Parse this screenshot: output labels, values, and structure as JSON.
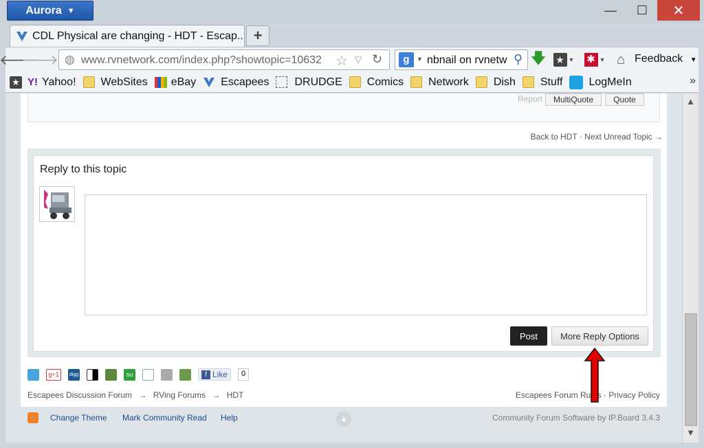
{
  "window": {
    "app_menu": "Aurora",
    "min": "—",
    "max": "☐",
    "close": "✕"
  },
  "tab": {
    "title": "CDL Physical are changing - HDT - Escap...",
    "new_tab": "+"
  },
  "nav": {
    "url": "www.rvnetwork.com/index.php?showtopic=10632",
    "search_text": "nbnail on rvnetw",
    "feedback": "Feedback"
  },
  "bookmarks": [
    {
      "label": "Yahoo!"
    },
    {
      "label": "WebSites"
    },
    {
      "label": "eBay"
    },
    {
      "label": "Escapees"
    },
    {
      "label": "DRUDGE"
    },
    {
      "label": "Comics"
    },
    {
      "label": "Network"
    },
    {
      "label": "Dish"
    },
    {
      "label": "Stuff"
    },
    {
      "label": "LogMeIn"
    }
  ],
  "post": {
    "report": "Report",
    "multiquote": "MultiQuote",
    "quote": "Quote"
  },
  "topic_nav": {
    "back": "Back to HDT",
    "sep": "·",
    "next": "Next Unread Topic →"
  },
  "reply": {
    "title": "Reply to this topic",
    "post_button": "Post",
    "more_button": "More Reply Options"
  },
  "share": {
    "like": "Like",
    "like_count": "0"
  },
  "breadcrumb": {
    "items": [
      "Escapees Discussion Forum",
      "RVing Forums",
      "HDT"
    ],
    "sep": "→"
  },
  "footer": {
    "rules": "Escapees Forum Rules",
    "sep": "·",
    "privacy": "Privacy Policy",
    "change_theme": "Change Theme",
    "mark_read": "Mark Community Read",
    "help": "Help",
    "powered": "Community Forum Software by IP.Board 3.4.3"
  },
  "colors": {
    "arrow": "#e20000",
    "close_button": "#c9463d",
    "post_button": "#222222"
  }
}
